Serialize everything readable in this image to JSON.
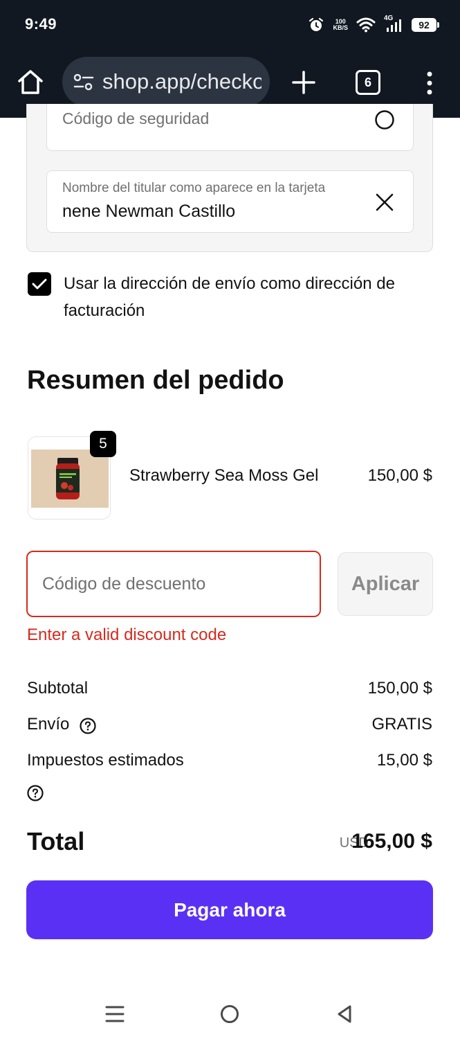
{
  "status_bar": {
    "time": "9:49",
    "net_speed_value": "100",
    "net_speed_unit": "KB/S",
    "network": "4G",
    "battery": "92"
  },
  "browser": {
    "url": "shop.app/checkout",
    "tab_count": "6"
  },
  "payment_form": {
    "security_code_label": "Código de seguridad",
    "cardholder_label": "Nombre del titular como aparece en la tarjeta",
    "cardholder_value": "nene Newman Castillo"
  },
  "billing": {
    "checked": true,
    "label": "Usar la dirección de envío como dirección de facturación"
  },
  "summary": {
    "title": "Resumen del pedido",
    "item": {
      "name": "Strawberry Sea Moss Gel",
      "price": "150,00 $",
      "quantity": "5"
    },
    "discount": {
      "placeholder": "Código de descuento",
      "apply_label": "Aplicar",
      "error": "Enter a valid discount code"
    },
    "subtotal_label": "Subtotal",
    "subtotal_value": "150,00 $",
    "shipping_label": "Envío",
    "shipping_value": "GRATIS",
    "taxes_label": "Impuestos estimados",
    "taxes_value": "15,00 $",
    "total_label": "Total",
    "total_currency": "USD",
    "total_value": "165,00 $",
    "pay_label": "Pagar ahora"
  },
  "colors": {
    "accent": "#5a31f4",
    "error": "#d52a1d",
    "chrome": "#111821"
  }
}
